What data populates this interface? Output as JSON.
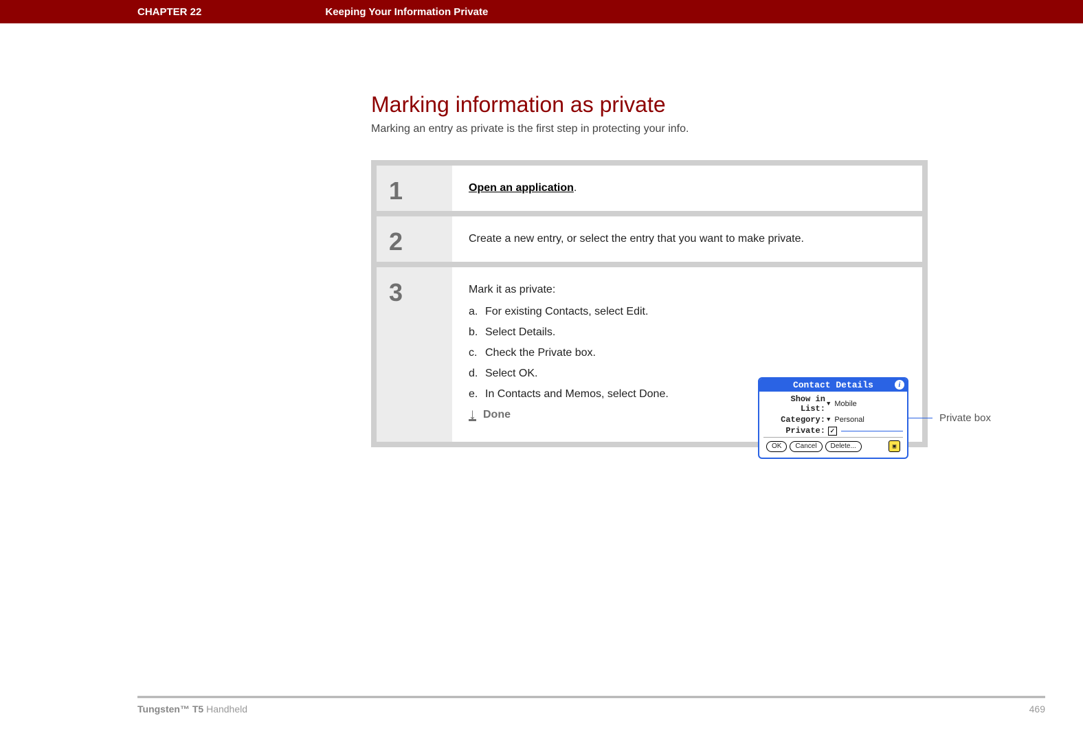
{
  "header": {
    "chapter_label": "CHAPTER 22",
    "chapter_title": "Keeping Your Information Private"
  },
  "page": {
    "title": "Marking information as private",
    "subtitle": "Marking an entry as private is the first step in protecting your info."
  },
  "steps": [
    {
      "num": "1",
      "link_text": "Open an application",
      "suffix": "."
    },
    {
      "num": "2",
      "text": "Create a new entry, or select the entry that you want to make private."
    },
    {
      "num": "3",
      "intro": "Mark it as private:",
      "substeps": [
        {
          "letter": "a.",
          "text": "For existing Contacts, select Edit."
        },
        {
          "letter": "b.",
          "text": "Select Details."
        },
        {
          "letter": "c.",
          "text": "Check the Private box."
        },
        {
          "letter": "d.",
          "text": "Select OK."
        },
        {
          "letter": "e.",
          "text": "In Contacts and Memos, select Done."
        }
      ],
      "done_label": "Done"
    }
  ],
  "dialog": {
    "title": "Contact Details",
    "fields": {
      "show_in_list_label": "Show in List:",
      "show_in_list_value": "Mobile",
      "category_label": "Category:",
      "category_value": "Personal",
      "private_label": "Private:"
    },
    "buttons": {
      "ok": "OK",
      "cancel": "Cancel",
      "delete": "Delete..."
    }
  },
  "callout": {
    "label": "Private box"
  },
  "footer": {
    "product_bold": "Tungsten™ T5",
    "product_rest": " Handheld",
    "page_number": "469"
  }
}
